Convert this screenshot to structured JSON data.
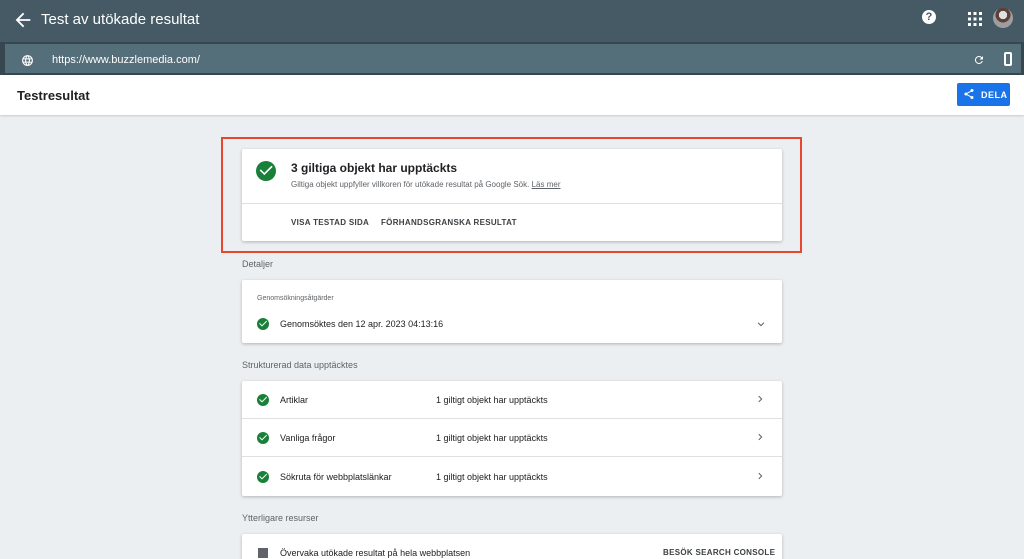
{
  "header": {
    "title": "Test av utökade resultat",
    "help_icon": "?"
  },
  "urlbar": {
    "url": "https://www.buzzlemedia.com/"
  },
  "subheader": {
    "title": "Testresultat",
    "share_label": "DELA"
  },
  "summary": {
    "headline": "3 giltiga objekt har upptäckts",
    "description": "Giltiga objekt uppfyller villkoren för utökade resultat på Google Sök.",
    "learn_more": "Läs mer",
    "actions": [
      "VISA TESTAD SIDA",
      "FÖRHANDSGRANSKA RESULTAT"
    ]
  },
  "details": {
    "section_label": "Detaljer",
    "caption": "Genomsökningsåtgärder",
    "crawled_text": "Genomsöktes den 12 apr. 2023 04:13:16"
  },
  "structured": {
    "section_label": "Strukturerad data upptäcktes",
    "rows": [
      {
        "name": "Artiklar",
        "value": "1 giltigt objekt har upptäckts"
      },
      {
        "name": "Vanliga frågor",
        "value": "1 giltigt objekt har upptäckts"
      },
      {
        "name": "Sökruta för webbplatslänkar",
        "value": "1 giltigt objekt har upptäckts"
      }
    ]
  },
  "resources": {
    "section_label": "Ytterligare resurser",
    "item_text": "Övervaka utökade resultat på hela webbplatsen",
    "button": "BESÖK SEARCH CONSOLE"
  },
  "colors": {
    "appbar": "#455a64",
    "success": "#188038",
    "accent": "#1a73e8",
    "highlight": "#e8472e"
  }
}
